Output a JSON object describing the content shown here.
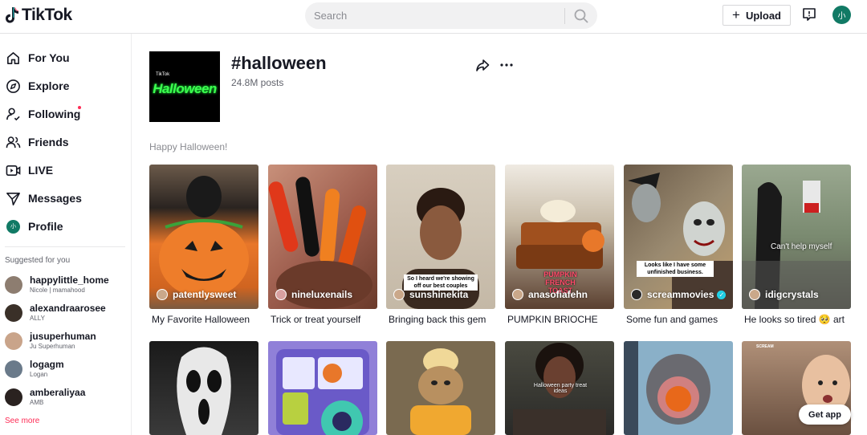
{
  "app": {
    "name": "TikTok",
    "avatar_initial": "小"
  },
  "search": {
    "placeholder": "Search"
  },
  "header": {
    "upload_label": "Upload"
  },
  "sidebar": {
    "nav": [
      {
        "label": "For You",
        "icon": "home-icon"
      },
      {
        "label": "Explore",
        "icon": "compass-icon"
      },
      {
        "label": "Following",
        "icon": "user-follow-icon"
      },
      {
        "label": "Friends",
        "icon": "friends-icon"
      },
      {
        "label": "LIVE",
        "icon": "live-icon"
      },
      {
        "label": "Messages",
        "icon": "send-icon"
      },
      {
        "label": "Profile",
        "icon": "avatar"
      }
    ],
    "suggested_title": "Suggested for you",
    "accounts": [
      {
        "name": "happylittle_home",
        "sub": "Nicole | mamahood"
      },
      {
        "name": "alexandraarosee",
        "sub": "ALLY"
      },
      {
        "name": "jusuperhuman",
        "sub": "Ju Superhuman"
      },
      {
        "name": "logagm",
        "sub": "Logan"
      },
      {
        "name": "amberaliyaa",
        "sub": "AMB"
      }
    ],
    "see_more": "See more"
  },
  "tag": {
    "cover_brand": "TikTok",
    "cover_word": "Halloween",
    "title": "#halloween",
    "posts": "24.8M posts",
    "description": "Happy Halloween!"
  },
  "videos": [
    {
      "user": "patentlysweet",
      "caption": "My Favorite Halloween",
      "colors": [
        "#7a6350",
        "#e8772a"
      ]
    },
    {
      "user": "nineluxenails",
      "caption": "Trick or treat yourself",
      "colors": [
        "#b87058",
        "#e05a1e"
      ]
    },
    {
      "user": "sunshinekita",
      "caption": "Bringing back this gem",
      "overlay": "So I heard we're showing off our best couples",
      "colors": [
        "#d2c6b4",
        "#6e4a38"
      ]
    },
    {
      "user": "anasofiafehn",
      "caption": "PUMPKIN BRIOCHE",
      "overlay": "PUMPKIN FRENCH TOAST",
      "colors": [
        "#e8e4dc",
        "#8a4a22"
      ]
    },
    {
      "user": "screammovies",
      "caption": "Some fun and games",
      "overlay": "Looks like I have some unfinished business.",
      "verified": true,
      "colors": [
        "#6b5a44",
        "#b5a890"
      ]
    },
    {
      "user": "idigcrystals",
      "caption": "He looks so tired 🥺 art",
      "overlay": "Can't help myself",
      "colors": [
        "#8a9a7a",
        "#2a2a2a"
      ]
    }
  ],
  "second_row_overlay": "Halloween party treat ideas",
  "second_row_scream": "SCREAM",
  "get_app": "Get app"
}
